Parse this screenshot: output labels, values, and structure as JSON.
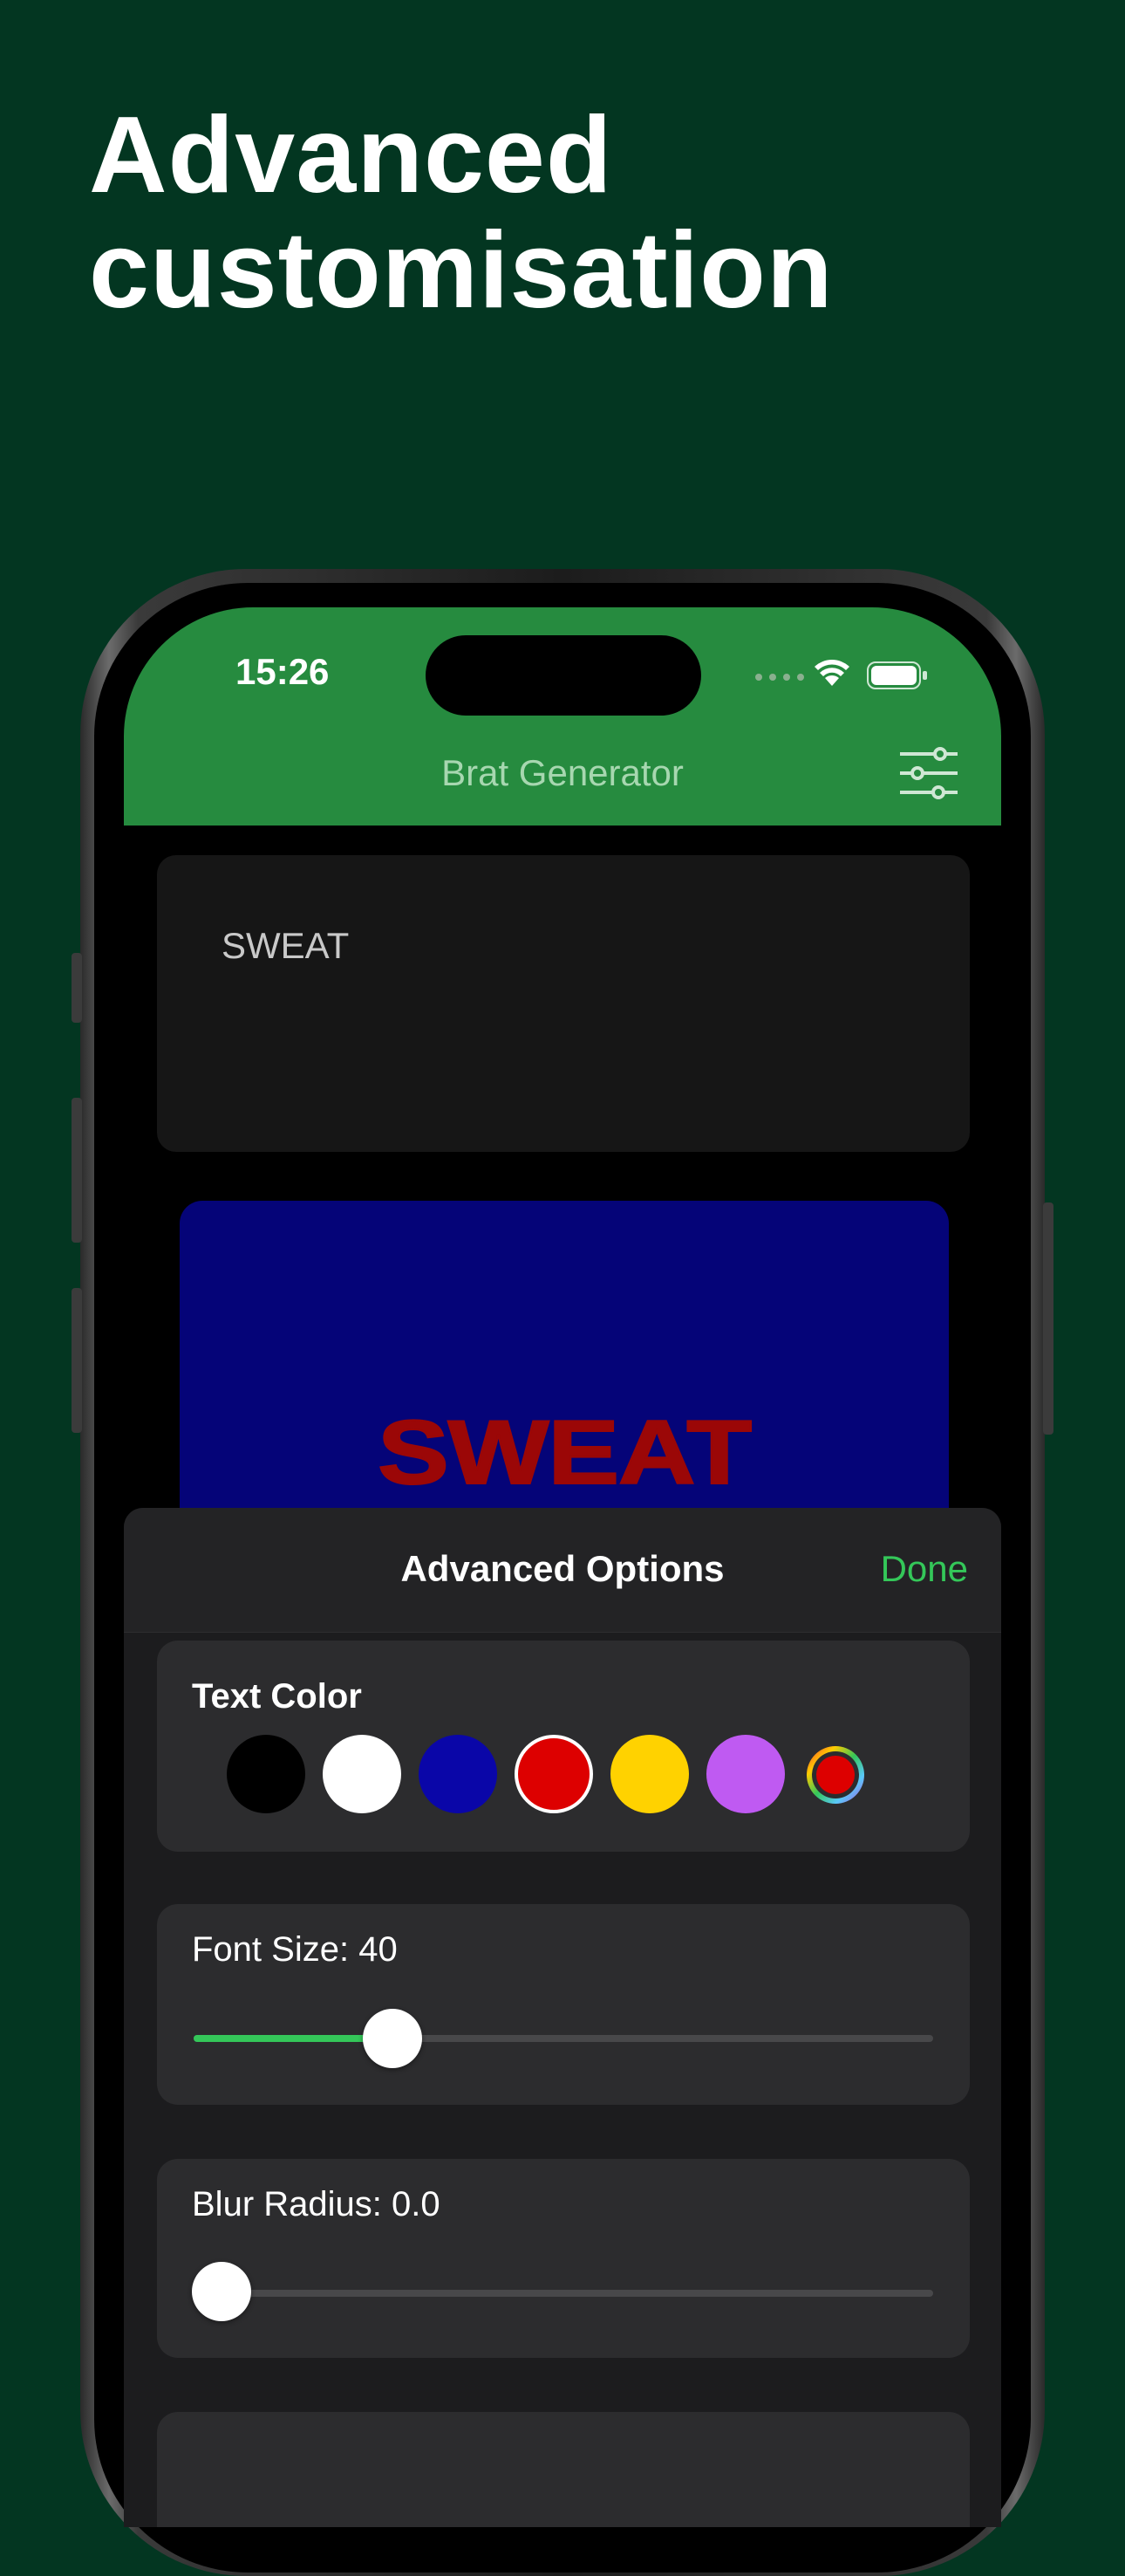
{
  "headline": {
    "line1": "Advanced",
    "line2": "customisation"
  },
  "status_bar": {
    "time": "15:26"
  },
  "nav": {
    "title": "Brat Generator",
    "settings_icon": "sliders-icon"
  },
  "editor": {
    "text": "SWEAT"
  },
  "preview": {
    "text": "SWEAT",
    "background": "#050478",
    "text_color": "#9b0707"
  },
  "sheet": {
    "title": "Advanced Options",
    "done_label": "Done",
    "text_color": {
      "label": "Text Color",
      "swatches": [
        "#000000",
        "#ffffff",
        "#0a06a8",
        "#dd0000",
        "#ffd200",
        "#bf5af2"
      ],
      "selected": "#dd0000",
      "custom_icon": "color-wheel-icon"
    },
    "font_size": {
      "label": "Font Size: 40",
      "value_fraction": 0.27
    },
    "blur_radius": {
      "label": "Blur Radius: 0.0",
      "value_fraction": 0.0
    }
  },
  "colors": {
    "accent": "#34c759",
    "nav_bar": "#268b3f",
    "page_background": "#033621"
  }
}
